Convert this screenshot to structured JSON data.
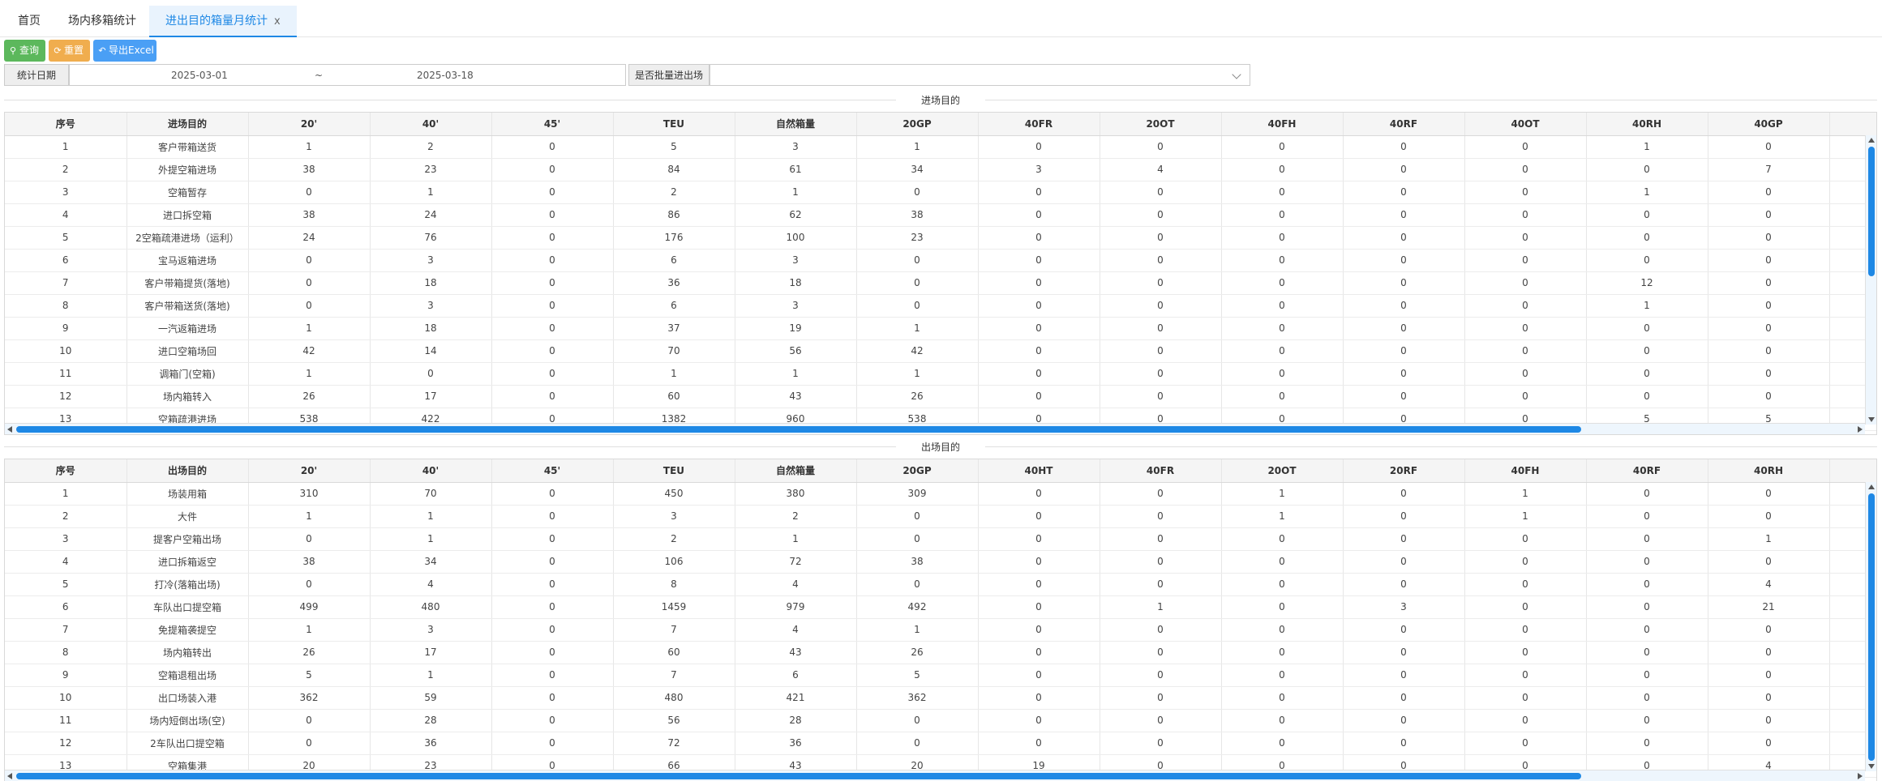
{
  "tabs": [
    {
      "label": "首页"
    },
    {
      "label": "场内移箱统计"
    },
    {
      "label": "进出目的箱量月统计",
      "close": "x"
    }
  ],
  "toolbar": {
    "query_label": "查询",
    "reset_label": "重置",
    "export_label": "导出Excel"
  },
  "filter": {
    "date_label": "统计日期",
    "date_start": "2025-03-01",
    "date_sep": "~",
    "date_end": "2025-03-18",
    "batch_label": "是否批量进出场",
    "batch_value": ""
  },
  "inbound": {
    "title": "进场目的",
    "columns": [
      "序号",
      "进场目的",
      "20'",
      "40'",
      "45'",
      "TEU",
      "自然箱量",
      "20GP",
      "40FR",
      "20OT",
      "40FH",
      "40RF",
      "40OT",
      "40RH",
      "40GP",
      ""
    ],
    "rows": [
      [
        "1",
        "客户带箱送货",
        "1",
        "2",
        "0",
        "5",
        "3",
        "1",
        "0",
        "0",
        "0",
        "0",
        "0",
        "1",
        "0",
        ""
      ],
      [
        "2",
        "外提空箱进场",
        "38",
        "23",
        "0",
        "84",
        "61",
        "34",
        "3",
        "4",
        "0",
        "0",
        "0",
        "0",
        "7",
        ""
      ],
      [
        "3",
        "空箱暂存",
        "0",
        "1",
        "0",
        "2",
        "1",
        "0",
        "0",
        "0",
        "0",
        "0",
        "0",
        "1",
        "0",
        ""
      ],
      [
        "4",
        "进口拆空箱",
        "38",
        "24",
        "0",
        "86",
        "62",
        "38",
        "0",
        "0",
        "0",
        "0",
        "0",
        "0",
        "0",
        ""
      ],
      [
        "5",
        "2空箱疏港进场（运利）",
        "24",
        "76",
        "0",
        "176",
        "100",
        "23",
        "0",
        "0",
        "0",
        "0",
        "0",
        "0",
        "0",
        ""
      ],
      [
        "6",
        "宝马返箱进场",
        "0",
        "3",
        "0",
        "6",
        "3",
        "0",
        "0",
        "0",
        "0",
        "0",
        "0",
        "0",
        "0",
        ""
      ],
      [
        "7",
        "客户带箱提货(落地)",
        "0",
        "18",
        "0",
        "36",
        "18",
        "0",
        "0",
        "0",
        "0",
        "0",
        "0",
        "12",
        "0",
        ""
      ],
      [
        "8",
        "客户带箱送货(落地)",
        "0",
        "3",
        "0",
        "6",
        "3",
        "0",
        "0",
        "0",
        "0",
        "0",
        "0",
        "1",
        "0",
        ""
      ],
      [
        "9",
        "一汽返箱进场",
        "1",
        "18",
        "0",
        "37",
        "19",
        "1",
        "0",
        "0",
        "0",
        "0",
        "0",
        "0",
        "0",
        ""
      ],
      [
        "10",
        "进口空箱场回",
        "42",
        "14",
        "0",
        "70",
        "56",
        "42",
        "0",
        "0",
        "0",
        "0",
        "0",
        "0",
        "0",
        ""
      ],
      [
        "11",
        "调箱门(空箱)",
        "1",
        "0",
        "0",
        "1",
        "1",
        "1",
        "0",
        "0",
        "0",
        "0",
        "0",
        "0",
        "0",
        ""
      ],
      [
        "12",
        "场内箱转入",
        "26",
        "17",
        "0",
        "60",
        "43",
        "26",
        "0",
        "0",
        "0",
        "0",
        "0",
        "0",
        "0",
        ""
      ],
      [
        "13",
        "空箱疏港进场",
        "538",
        "422",
        "0",
        "1382",
        "960",
        "538",
        "0",
        "0",
        "0",
        "0",
        "0",
        "5",
        "5",
        ""
      ]
    ]
  },
  "outbound": {
    "title": "出场目的",
    "columns": [
      "序号",
      "出场目的",
      "20'",
      "40'",
      "45'",
      "TEU",
      "自然箱量",
      "20GP",
      "40HT",
      "40FR",
      "20OT",
      "20RF",
      "40FH",
      "40RF",
      "40RH",
      ""
    ],
    "rows": [
      [
        "1",
        "场装用箱",
        "310",
        "70",
        "0",
        "450",
        "380",
        "309",
        "0",
        "0",
        "1",
        "0",
        "1",
        "0",
        "0",
        ""
      ],
      [
        "2",
        "大件",
        "1",
        "1",
        "0",
        "3",
        "2",
        "0",
        "0",
        "0",
        "1",
        "0",
        "1",
        "0",
        "0",
        ""
      ],
      [
        "3",
        "提客户空箱出场",
        "0",
        "1",
        "0",
        "2",
        "1",
        "0",
        "0",
        "0",
        "0",
        "0",
        "0",
        "0",
        "1",
        ""
      ],
      [
        "4",
        "进口拆箱返空",
        "38",
        "34",
        "0",
        "106",
        "72",
        "38",
        "0",
        "0",
        "0",
        "0",
        "0",
        "0",
        "0",
        ""
      ],
      [
        "5",
        "打冷(落箱出场)",
        "0",
        "4",
        "0",
        "8",
        "4",
        "0",
        "0",
        "0",
        "0",
        "0",
        "0",
        "0",
        "4",
        ""
      ],
      [
        "6",
        "车队出口提空箱",
        "499",
        "480",
        "0",
        "1459",
        "979",
        "492",
        "0",
        "1",
        "0",
        "3",
        "0",
        "0",
        "21",
        ""
      ],
      [
        "7",
        "免提箱袭提空",
        "1",
        "3",
        "0",
        "7",
        "4",
        "1",
        "0",
        "0",
        "0",
        "0",
        "0",
        "0",
        "0",
        ""
      ],
      [
        "8",
        "场内箱转出",
        "26",
        "17",
        "0",
        "60",
        "43",
        "26",
        "0",
        "0",
        "0",
        "0",
        "0",
        "0",
        "0",
        ""
      ],
      [
        "9",
        "空箱退租出场",
        "5",
        "1",
        "0",
        "7",
        "6",
        "5",
        "0",
        "0",
        "0",
        "0",
        "0",
        "0",
        "0",
        ""
      ],
      [
        "10",
        "出口场装入港",
        "362",
        "59",
        "0",
        "480",
        "421",
        "362",
        "0",
        "0",
        "0",
        "0",
        "0",
        "0",
        "0",
        ""
      ],
      [
        "11",
        "场内短倒出场(空)",
        "0",
        "28",
        "0",
        "56",
        "28",
        "0",
        "0",
        "0",
        "0",
        "0",
        "0",
        "0",
        "0",
        ""
      ],
      [
        "12",
        "2车队出口提空箱",
        "0",
        "36",
        "0",
        "72",
        "36",
        "0",
        "0",
        "0",
        "0",
        "0",
        "0",
        "0",
        "0",
        ""
      ],
      [
        "13",
        "空箱集港",
        "20",
        "23",
        "0",
        "66",
        "43",
        "20",
        "19",
        "0",
        "0",
        "0",
        "0",
        "0",
        "4",
        ""
      ]
    ]
  },
  "colors": {
    "accent": "#1e88e5",
    "query": "#5cb85c",
    "reset": "#f0ad4e",
    "export": "#4a9ff5"
  }
}
